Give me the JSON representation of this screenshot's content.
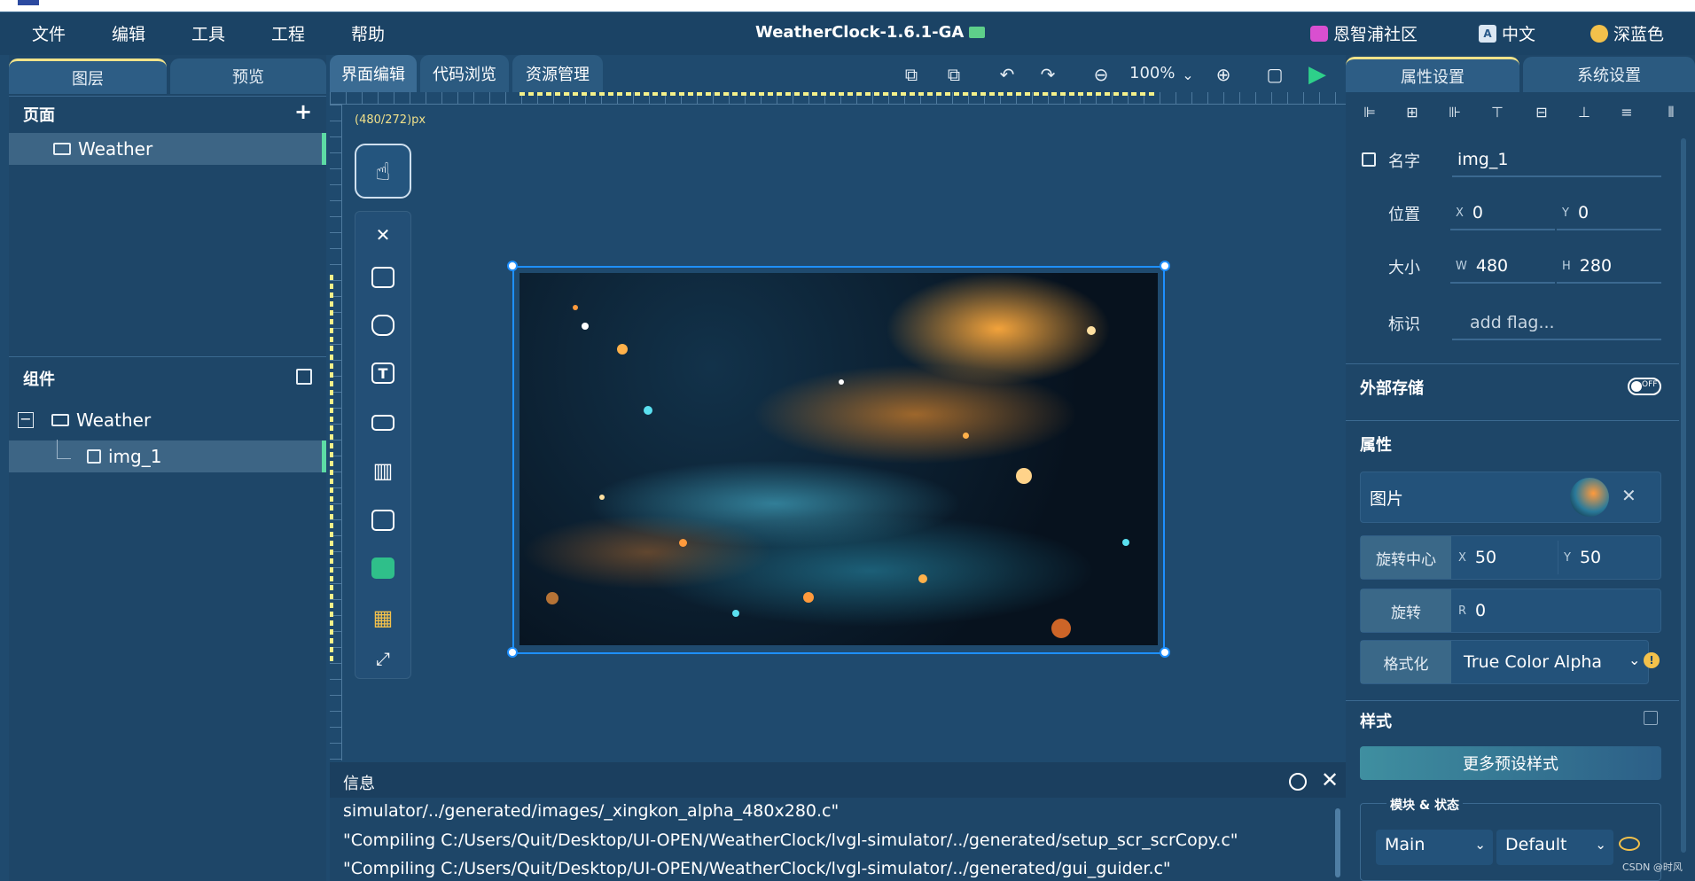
{
  "window": {
    "app_title": "WeatherClock-1.6.1-GA"
  },
  "menu": {
    "items": [
      "文件",
      "编辑",
      "工具",
      "工程",
      "帮助"
    ]
  },
  "top_right": {
    "community": "恩智浦社区",
    "language": "中文",
    "theme": "深蓝色"
  },
  "left_tabs": [
    "图层",
    "预览"
  ],
  "pages": {
    "title": "页面",
    "add": "+",
    "items": [
      "Weather"
    ]
  },
  "components": {
    "title": "组件",
    "collapse": "−",
    "root": "Weather",
    "child": "img_1"
  },
  "editor_tabs": [
    "界面编辑",
    "代码浏览",
    "资源管理"
  ],
  "toolbar": {
    "zoom": "100%"
  },
  "canvas": {
    "size_label": "(480/272)px"
  },
  "info": {
    "title": "信息",
    "lines": [
      "simulator/../generated/images/_xingkon_alpha_480x280.c\"",
      "\"Compiling C:/Users/Quit/Desktop/UI-OPEN/WeatherClock/lvgl-simulator/../generated/setup_scr_scrCopy.c\"",
      "\"Compiling C:/Users/Quit/Desktop/UI-OPEN/WeatherClock/lvgl-simulator/../generated/gui_guider.c\""
    ]
  },
  "right_tabs": [
    "属性设置",
    "系统设置"
  ],
  "props": {
    "name_label": "名字",
    "name_value": "img_1",
    "position_label": "位置",
    "pos_x_axis": "X",
    "pos_x": "0",
    "pos_y_axis": "Y",
    "pos_y": "0",
    "size_label": "大小",
    "w_axis": "W",
    "w": "480",
    "h_axis": "H",
    "h": "280",
    "flag_label": "标识",
    "flag_placeholder": "add flag...",
    "external_storage": "外部存储",
    "toggle_text": "OFF",
    "attributes": "属性",
    "image_label": "图片",
    "rot_center_label": "旋转中心",
    "rc_x_axis": "X",
    "rc_x": "50",
    "rc_y_axis": "Y",
    "rc_y": "50",
    "rotate_label": "旋转",
    "r_axis": "R",
    "r": "0",
    "format_label": "格式化",
    "format_value": "True Color Alpha",
    "style_title": "样式",
    "preset_btn": "更多预设样式",
    "module_state": "模块 & 状态",
    "module_value": "Main",
    "state_value": "Default"
  },
  "watermark": "CSDN @时风",
  "colors": {
    "accent": "#5ddba5",
    "selection": "#1e90ff",
    "ruler_mark": "#f5f18a",
    "run": "#2ed08a"
  }
}
